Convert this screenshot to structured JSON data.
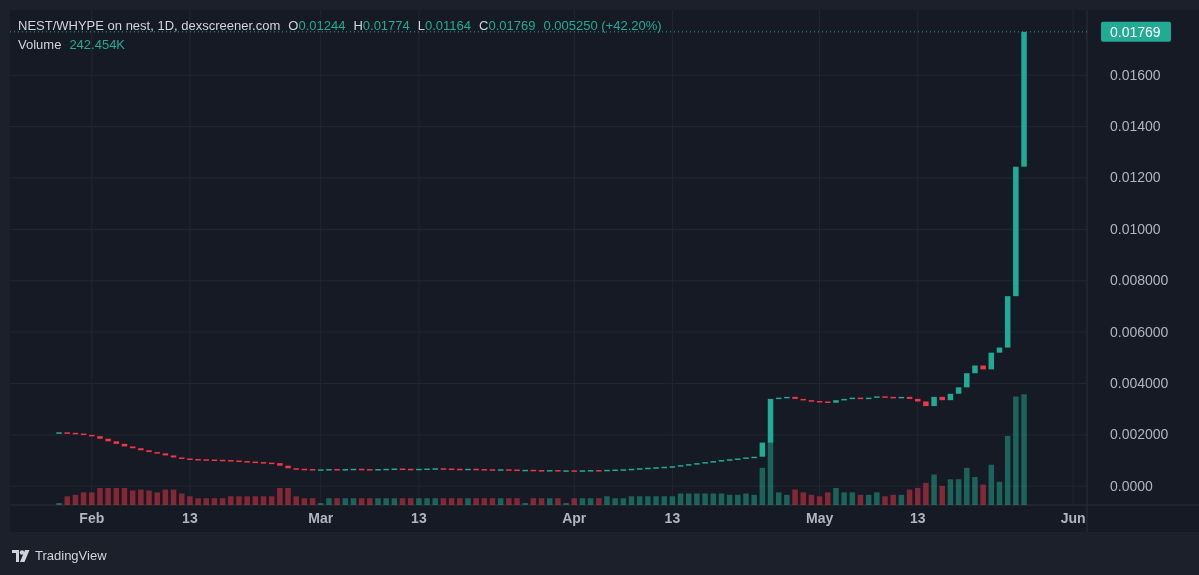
{
  "chart": {
    "legend": {
      "title": "NEST/WHYPE on nest, 1D, dexscreener.com",
      "ohlc": [
        {
          "label": "O",
          "value": "0.01244"
        },
        {
          "label": "H",
          "value": "0.01774"
        },
        {
          "label": "L",
          "value": "0.01164"
        },
        {
          "label": "C",
          "value": "0.01769"
        }
      ],
      "change": "0.005250 (+42.20%)",
      "volume_label": "Volume",
      "volume_value": "242.454K"
    },
    "last_price": "0.01769",
    "price_axis": [
      "0.01600",
      "0.01400",
      "0.01200",
      "0.01000",
      "0.008000",
      "0.006000",
      "0.004000",
      "0.002000",
      "0.0000"
    ],
    "time_axis": [
      "Feb",
      "13",
      "Mar",
      "13",
      "Apr",
      "13",
      "May",
      "13",
      "Jun"
    ]
  },
  "footer": {
    "brand": "TradingView"
  }
}
